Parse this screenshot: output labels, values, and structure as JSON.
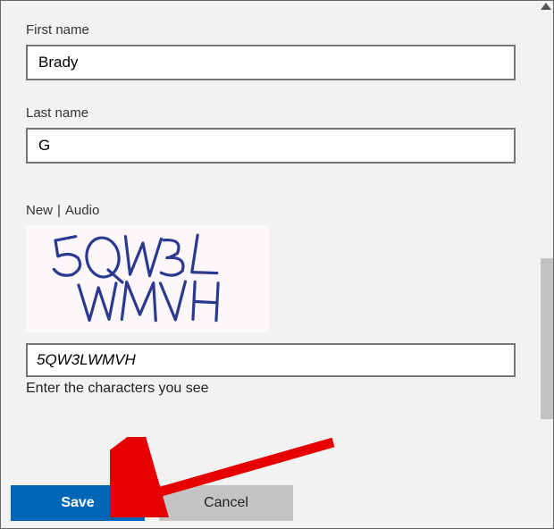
{
  "form": {
    "first_name": {
      "label": "First name",
      "value": "Brady"
    },
    "last_name": {
      "label": "Last name",
      "value": "G"
    }
  },
  "captcha": {
    "new_label": "New",
    "audio_label": "Audio",
    "image_text": "5QW3L WMVH",
    "input_value": "5QW3LWMVH",
    "hint": "Enter the characters you see"
  },
  "buttons": {
    "save": "Save",
    "cancel": "Cancel"
  }
}
